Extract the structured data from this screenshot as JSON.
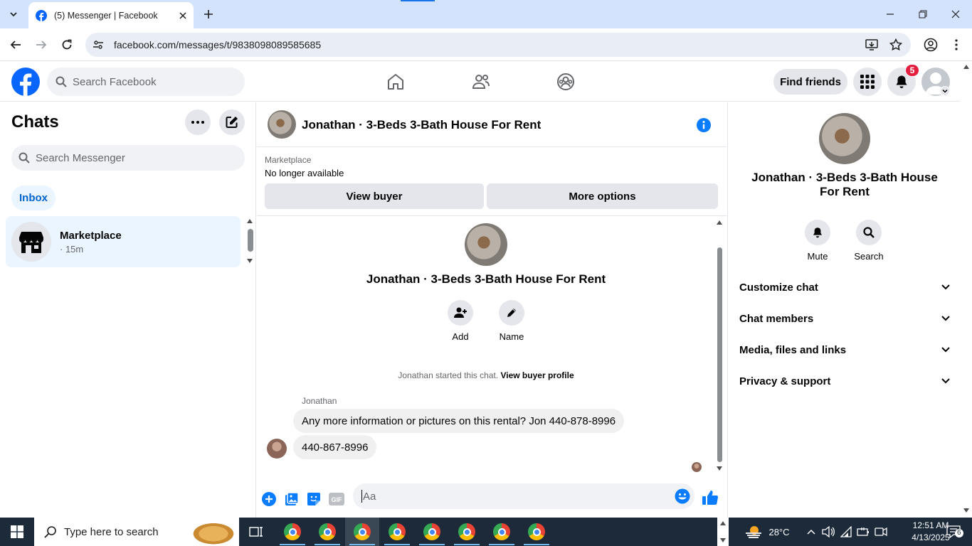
{
  "browser": {
    "tab_title": "(5) Messenger | Facebook",
    "url": "facebook.com/messages/t/9838098089585685"
  },
  "header": {
    "search_placeholder": "Search Facebook",
    "find_friends": "Find friends",
    "notifications_count": "5"
  },
  "chats": {
    "title": "Chats",
    "search_placeholder": "Search Messenger",
    "filter": "Inbox",
    "items": [
      {
        "name": "Marketplace",
        "time": "· 15m"
      }
    ]
  },
  "conversation": {
    "title": "Jonathan · 3-Beds 3-Bath House For Rent",
    "marketplace_label": "Marketplace",
    "listing_status": "No longer available",
    "view_buyer": "View buyer",
    "more_options": "More options",
    "actions": [
      {
        "label": "Add",
        "icon": "add-person-icon"
      },
      {
        "label": "Name",
        "icon": "pencil-icon"
      }
    ],
    "started_text": "Jonathan started this chat.",
    "view_buyer_profile": "View buyer profile",
    "sender": "Jonathan",
    "messages": [
      "Any more information or pictures on this rental? Jon 440-878-8996",
      "440-867-8996"
    ],
    "input_placeholder": "Aa"
  },
  "details": {
    "name": "Jonathan · 3-Beds 3-Bath House For Rent",
    "actions": [
      {
        "label": "Mute",
        "icon": "bell-icon"
      },
      {
        "label": "Search",
        "icon": "search-icon"
      }
    ],
    "sections": [
      "Customize chat",
      "Chat members",
      "Media, files and links",
      "Privacy & support"
    ]
  },
  "taskbar": {
    "search_placeholder": "Type here to search",
    "weather": "28°C",
    "time": "12:51 AM",
    "date": "4/13/2025",
    "notification_count": "6"
  },
  "colors": {
    "facebook_blue": "#0866ff",
    "messenger_accent": "#0a7cff",
    "badge_red": "#e41e3f"
  }
}
